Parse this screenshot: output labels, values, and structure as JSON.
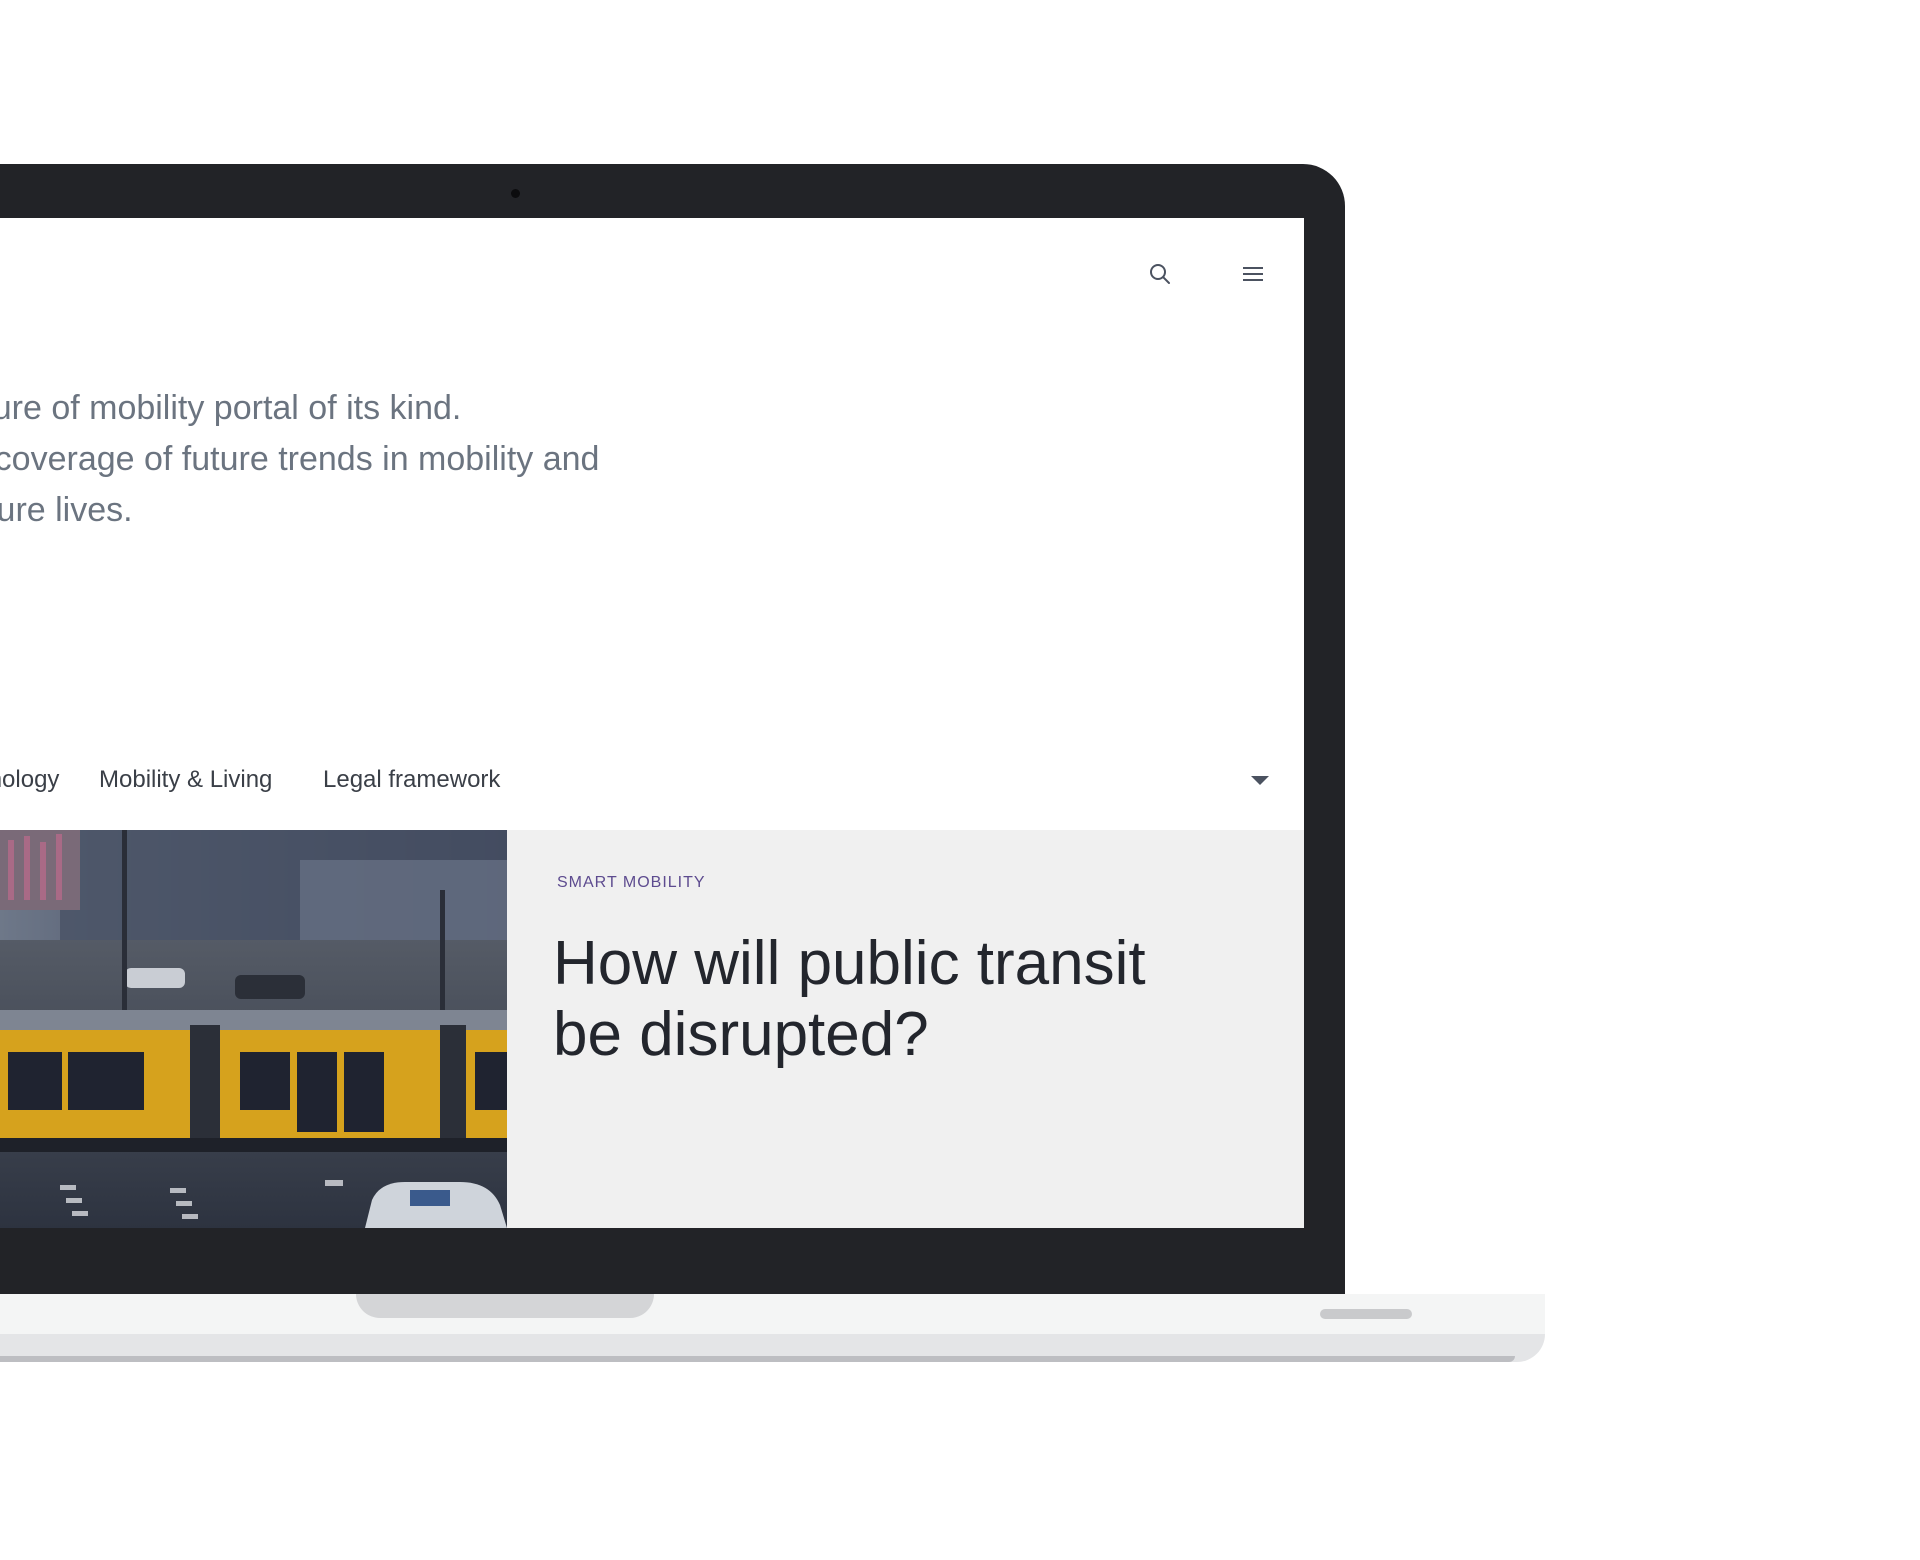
{
  "header": {
    "search_icon": "search-icon",
    "menu_icon": "hamburger-menu-icon"
  },
  "intro": {
    "lines": [
      "is the first future of mobility portal of its kind.",
      "international coverage of future trends in mobility and",
      "will shape future lives."
    ]
  },
  "nav": {
    "items": [
      {
        "label": "Technology"
      },
      {
        "label": "Mobility & Living"
      },
      {
        "label": "Legal framework"
      }
    ],
    "dropdown_icon": "caret-down-icon"
  },
  "teaser": {
    "image_alt": "tram",
    "category": "SMART MOBILITY",
    "title": "How will public transit be disrupted?"
  },
  "colors": {
    "bezel": "#222327",
    "intro_text": "#6b7480",
    "category_text": "#5d4b8f",
    "panel_bg": "#f0f0f0",
    "tram_yellow": "#d6a21d"
  }
}
